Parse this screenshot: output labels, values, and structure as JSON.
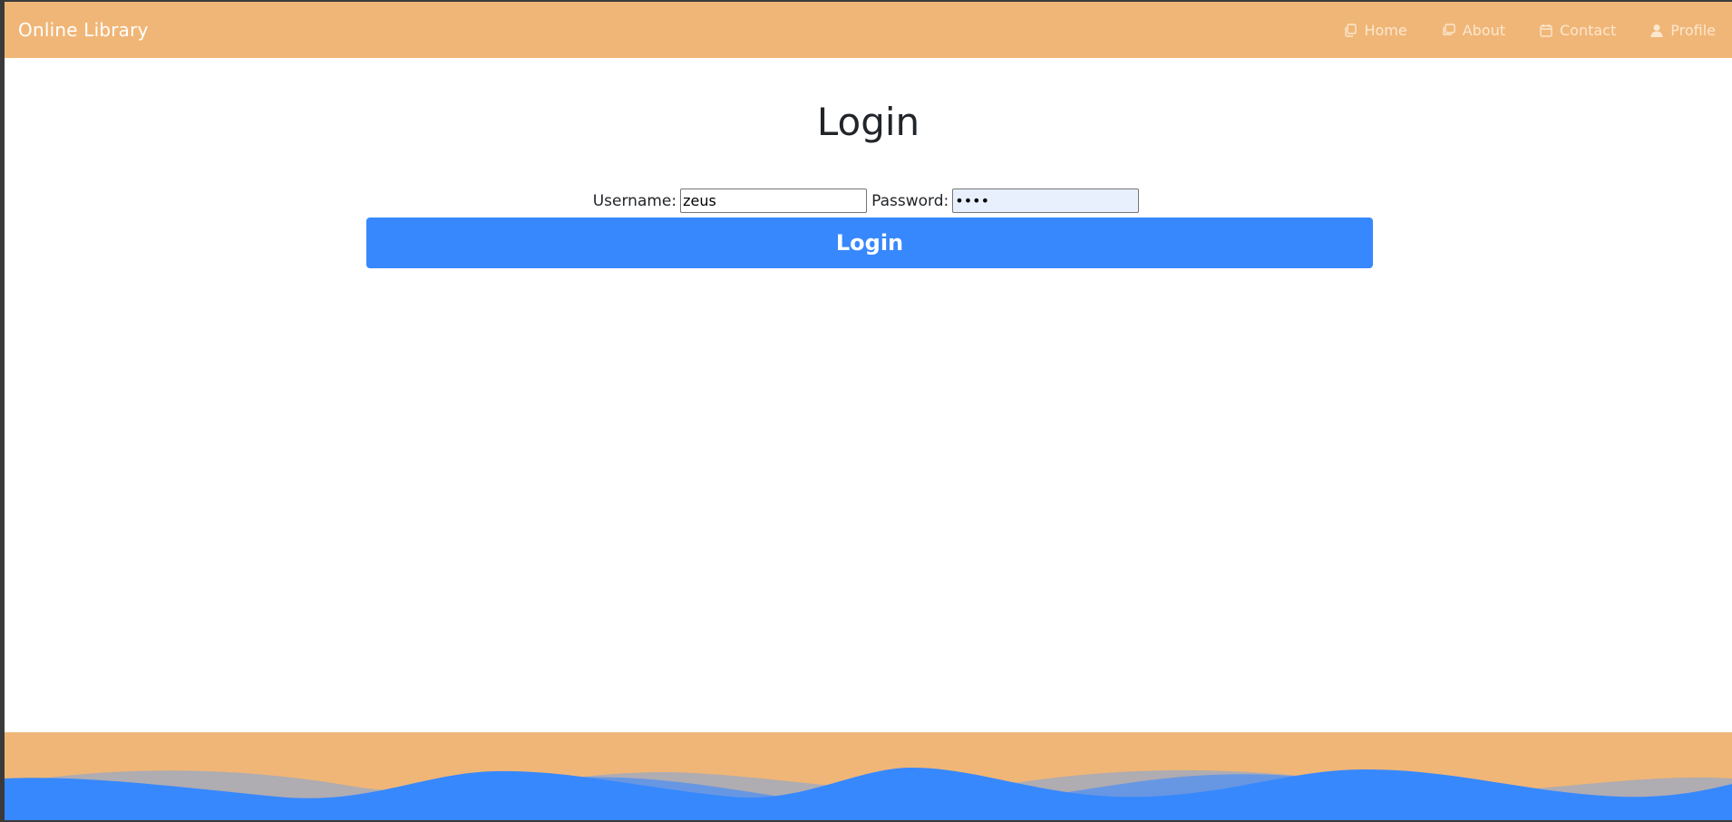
{
  "navbar": {
    "brand": "Online Library",
    "links": [
      {
        "label": "Home",
        "icon": "copy-icon"
      },
      {
        "label": "About",
        "icon": "window-icon"
      },
      {
        "label": "Contact",
        "icon": "calendar-icon"
      },
      {
        "label": "Profile",
        "icon": "user-icon"
      }
    ]
  },
  "main": {
    "title": "Login",
    "username_label": "Username:",
    "username_value": "zeus",
    "password_label": "Password:",
    "password_value": "••••",
    "login_button": "Login"
  },
  "colors": {
    "navbar_bg": "#f0b677",
    "button_bg": "#3788fd",
    "wave_blue": "#3788fd",
    "wave_light": "#5b9cf0"
  }
}
